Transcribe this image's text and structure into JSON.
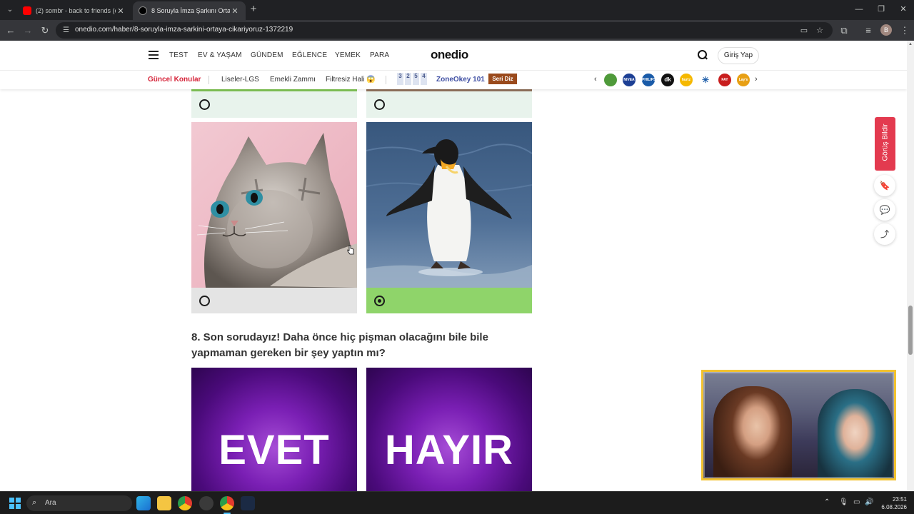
{
  "browser": {
    "tabs": [
      {
        "title": "(2) sombr - back to friends (offi",
        "close": "✕"
      },
      {
        "title": "8 Soruyla İmza Şarkını Ortaya Ç",
        "close": "✕"
      }
    ],
    "new_tab": "+",
    "url": "onedio.com/haber/8-soruyla-imza-sarkini-ortaya-cikariyoruz-1372219",
    "profile_initial": "B",
    "window_controls": {
      "minimize": "—",
      "restore": "❐",
      "close": "✕"
    }
  },
  "site": {
    "logo": "onedio",
    "nav": [
      "TEST",
      "EV & YAŞAM",
      "GÜNDEM",
      "EĞLENCE",
      "YEMEK",
      "PARA"
    ],
    "login_label": "Giriş Yap",
    "topics": {
      "hot_label": "Güncel Konular",
      "items": [
        "Liseler-LGS",
        "Emekli Zammı",
        "Filtresiz Hali 😱"
      ],
      "digits": [
        "3",
        "2",
        "5",
        "4"
      ],
      "zone_label": "ZoneOkey 101",
      "seri_label": "Seri Diz",
      "brands": [
        {
          "name": "tree-brand",
          "text": "",
          "color": "#4f9a3a"
        },
        {
          "name": "nivea",
          "text": "NIVEA",
          "color": "#1c3f94"
        },
        {
          "name": "philips",
          "text": "PHILIPS",
          "color": "#1a5ba8"
        },
        {
          "name": "dk",
          "text": "dk",
          "color": "#111111"
        },
        {
          "name": "hurriyet-brand",
          "text": "hurtz",
          "color": "#f5b800"
        },
        {
          "name": "snowflake-brand",
          "text": "✳",
          "color": "#ffffff"
        },
        {
          "name": "fairy-brand",
          "text": "FAY",
          "color": "#c81e1e"
        },
        {
          "name": "lays-brand",
          "text": "Lay's",
          "color": "#e8a014"
        }
      ]
    }
  },
  "quiz": {
    "question_8": "8. Son sorudayız! Daha önce hiç pişman olacağını bile bile yapmaman gereken bir şey yaptın mı?",
    "answers_8": [
      "EVET",
      "HAYIR"
    ],
    "selected_answer": "penguin"
  },
  "rail": {
    "feedback_label": "Görüş Bildir"
  },
  "taskbar": {
    "search_placeholder": "Ara",
    "time": "23:51",
    "date": "6.08.2026"
  },
  "colors": {
    "selected_card": "#8fd46a",
    "accent_red": "#d6263b",
    "quiz_purple": "#7a1fb4"
  }
}
